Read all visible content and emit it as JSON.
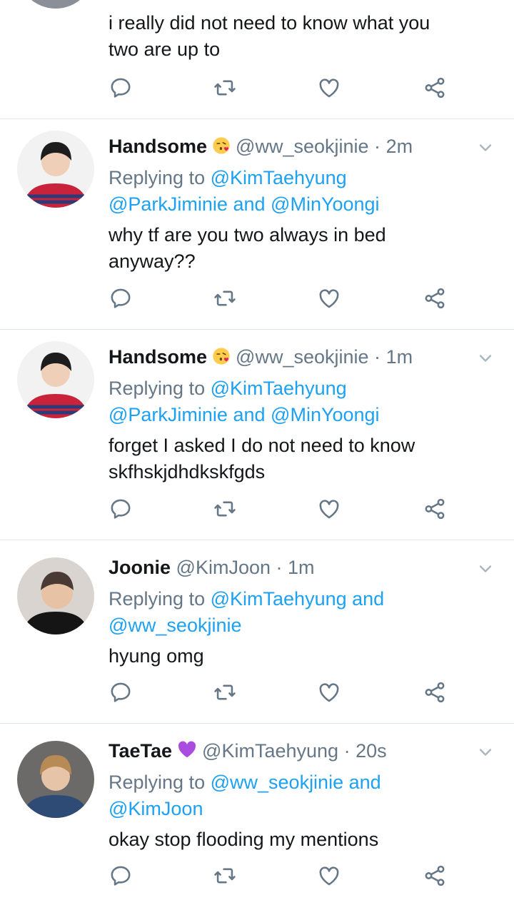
{
  "colors": {
    "accent": "#1da1f2",
    "muted": "#657786",
    "text": "#14171a",
    "divider": "#e1e8ed"
  },
  "tweets": [
    {
      "body_lines": [
        "i really did not need to know what you",
        "two are up to"
      ]
    },
    {
      "name": "Handsome",
      "emoji": "kissing-heart-emoji",
      "handle": "@ww_seokjinie",
      "sep": "·",
      "time": "2m",
      "reply_prefix": "Replying to",
      "reply_m1": "@KimTaehyung",
      "reply_m2": "@ParkJiminie",
      "reply_and": "and",
      "reply_m3": "@MinYoongi",
      "body_lines": [
        "why tf are you two always in bed",
        "anyway??"
      ]
    },
    {
      "name": "Handsome",
      "emoji": "kissing-heart-emoji",
      "handle": "@ww_seokjinie",
      "sep": "·",
      "time": "1m",
      "reply_prefix": "Replying to",
      "reply_m1": "@KimTaehyung",
      "reply_m2": "@ParkJiminie",
      "reply_and": "and",
      "reply_m3": "@MinYoongi",
      "body_lines": [
        "forget I asked I do not need to know",
        "skfhskjdhdkskfgds"
      ]
    },
    {
      "name": "Joonie",
      "handle": "@KimJoon",
      "sep": "·",
      "time": "1m",
      "reply_prefix": "Replying to",
      "reply_m1": "@KimTaehyung",
      "reply_and": "and",
      "reply_m2": "@ww_seokjinie",
      "body_lines": [
        "hyung omg"
      ]
    },
    {
      "name": "TaeTae",
      "emoji": "purple-heart-emoji",
      "handle": "@KimTaehyung",
      "sep": "·",
      "time": "20s",
      "reply_prefix": "Replying to",
      "reply_m1": "@ww_seokjinie",
      "reply_and": "and",
      "reply_m2": "@KimJoon",
      "body_lines": [
        "okay stop flooding my mentions"
      ]
    }
  ],
  "action_icons": [
    "reply-icon",
    "retweet-icon",
    "like-icon",
    "share-icon"
  ]
}
